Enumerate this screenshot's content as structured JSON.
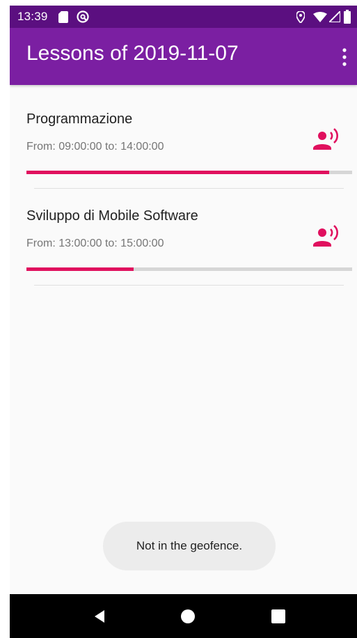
{
  "status_bar": {
    "time": "13:39",
    "icons": [
      "sd-card-icon",
      "sync-icon",
      "location-icon",
      "wifi-icon",
      "signal-icon",
      "battery-icon"
    ]
  },
  "app_bar": {
    "title": "Lessons of 2019-11-07",
    "menu_icon": "overflow-menu-icon"
  },
  "lessons": [
    {
      "name": "Programmazione",
      "time": "From: 09:00:00 to: 14:00:00",
      "progress": 0.93,
      "icon": "record-voice-icon"
    },
    {
      "name": "Sviluppo di Mobile Software",
      "time": "From: 13:00:00 to: 15:00:00",
      "progress": 0.33,
      "icon": "record-voice-icon"
    }
  ],
  "toast": {
    "message": "Not in the geofence."
  },
  "nav_bar": {
    "buttons": [
      "back-icon",
      "home-icon",
      "recents-icon"
    ]
  },
  "colors": {
    "status_bar": "#5b0f80",
    "app_bar": "#7b1fa2",
    "accent": "#e0105e",
    "track": "#d6d6d6"
  }
}
